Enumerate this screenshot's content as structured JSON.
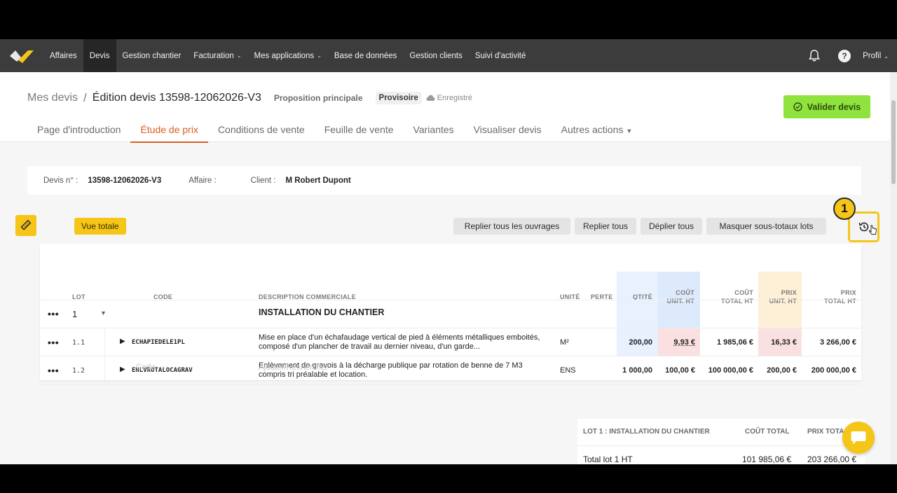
{
  "nav": {
    "items": [
      {
        "label": "Affaires",
        "active": false,
        "dropdown": false
      },
      {
        "label": "Devis",
        "active": true,
        "dropdown": false
      },
      {
        "label": "Gestion chantier",
        "active": false,
        "dropdown": false
      },
      {
        "label": "Facturation",
        "active": false,
        "dropdown": true
      },
      {
        "label": "Mes applications",
        "active": false,
        "dropdown": true
      },
      {
        "label": "Base de données",
        "active": false,
        "dropdown": false
      },
      {
        "label": "Gestion clients",
        "active": false,
        "dropdown": false
      },
      {
        "label": "Suivi d'activité",
        "active": false,
        "dropdown": false
      }
    ],
    "profile_label": "Profil",
    "help_glyph": "?"
  },
  "header": {
    "breadcrumb_root": "Mes devis",
    "separator": "/",
    "title": "Édition devis 13598-12062026-V3",
    "proposition": "Proposition principale",
    "status_badge": "Provisoire",
    "saved_label": "Enregistré",
    "validate_label": "Valider devis",
    "tabs": [
      {
        "label": "Page d'introduction",
        "active": false
      },
      {
        "label": "Étude de prix",
        "active": true
      },
      {
        "label": "Conditions de vente",
        "active": false
      },
      {
        "label": "Feuille de vente",
        "active": false
      },
      {
        "label": "Variantes",
        "active": false
      },
      {
        "label": "Visualiser devis",
        "active": false
      },
      {
        "label": "Autres actions",
        "active": false
      }
    ]
  },
  "info": {
    "devis_label": "Devis n° :",
    "devis_value": "13598-12062026-V3",
    "affaire_label": "Affaire :",
    "affaire_value": "",
    "client_label": "Client :",
    "client_value": "M Robert Dupont"
  },
  "toolbar": {
    "vue_totale": "Vue totale",
    "replier_ouvrages": "Replier tous les ouvrages",
    "replier_tous": "Replier tous",
    "deplier_tous": "Déplier tous",
    "masquer_sous_totaux": "Masquer sous-totaux lots",
    "step_number": "1"
  },
  "table": {
    "headers": {
      "lot": "LOT",
      "code": "CODE",
      "description": "DESCRIPTION COMMERCIALE",
      "unite": "UNITÉ",
      "perte": "PERTE",
      "qtite": "QTITÉ",
      "cout_unit_1": "COÛT",
      "cout_unit_2": "UNIT. HT",
      "cout_total_1": "COÛT",
      "cout_total_2": "TOTAL HT",
      "prix_unit_1": "PRIX",
      "prix_unit_2": "UNIT. HT",
      "prix_total_1": "PRIX",
      "prix_total_2": "TOTAL HT"
    },
    "lot_row": {
      "dots": "•••",
      "number": "1",
      "title": "INSTALLATION DU CHANTIER"
    },
    "rows": [
      {
        "dots": "•••",
        "num": "1.1",
        "code": "ECHAPIEDELE1PL",
        "description": "Mise en place d'un échafaudage vertical de pied à éléments métalliques emboités, composé d'un plancher de travail au dernier niveau, d'un garde...",
        "unite": "M²",
        "perte": "",
        "qtite": "200,00",
        "cout_unit": "9,93 €",
        "cout_total": "1 985,06 €",
        "prix_unit": "16,33 €",
        "prix_total": "3 266,00 €"
      },
      {
        "dots": "•••",
        "num": "1.2",
        "code": "ENLVROTALOCAGRAV",
        "description": "Enlèvement de gravois à la décharge publique par rotation de benne de 7 M3 compris tri préalable et location.",
        "unite": "ENS",
        "perte": "",
        "qtite": "1 000,00",
        "cout_unit": "100,00 €",
        "cout_total": "100 000,00 €",
        "prix_unit": "200,00 €",
        "prix_total": "200 000,00 €"
      }
    ],
    "add_row": {
      "code_placeholder": "Code",
      "search_placeholder": "Ajouter/Rechercher"
    }
  },
  "totals": {
    "header_label": "LOT 1 : INSTALLATION DU CHANTIER",
    "header_cout": "COÛT TOTAL",
    "header_prix": "PRIX TOTA",
    "row_label": "Total lot 1 HT",
    "row_cout": "101 985,06 €",
    "row_prix": "203 266,00 €"
  },
  "colors": {
    "accent_yellow": "#f5c518",
    "accent_orange": "#d95f1f",
    "validate_green": "#8fe33c",
    "nav_bg": "#3c3c3c",
    "qtite_bg": "#e8f1fd",
    "cout_unit_bg": "#ddeafb",
    "prix_unit_bg": "#fdf0d6",
    "alert_bg": "#fbe0e2"
  },
  "icons": [
    "logo-icon",
    "bell-icon",
    "help-icon",
    "check-circle-icon",
    "cloud-icon",
    "ruler-icon",
    "history-icon",
    "chevron-down-icon",
    "triangle-right-icon",
    "chat-icon"
  ]
}
